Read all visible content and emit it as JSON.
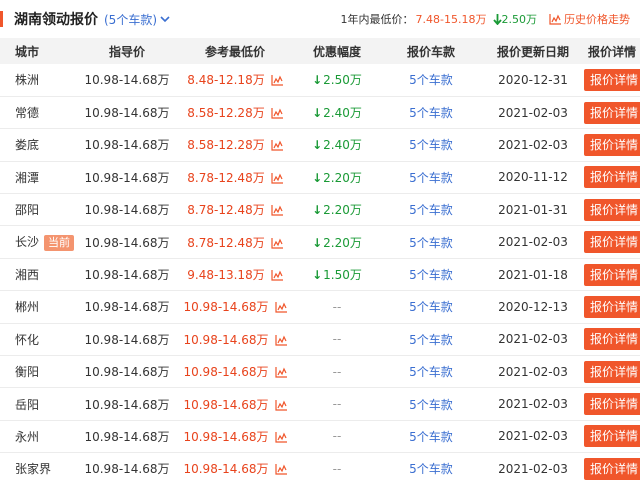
{
  "header": {
    "title": "湖南领动报价",
    "model_count": "(5个车款)",
    "lowest_label": "1年内最低价：",
    "lowest_range": "7.48-15.18万",
    "max_discount": "2.50万",
    "history_label": "历史价格走势"
  },
  "columns": {
    "city": "城市",
    "msrp": "指导价",
    "ref_price": "参考最低价",
    "discount": "优惠幅度",
    "models": "报价车款",
    "updated": "报价更新日期",
    "details": "报价详情"
  },
  "current_badge": "当前",
  "rows": [
    {
      "city": "株洲",
      "msrp": "10.98-14.68万",
      "ref": "8.48-12.18万",
      "disc": "2.50万",
      "models": "5个车款",
      "date": "2020-12-31",
      "btn": "报价详情"
    },
    {
      "city": "常德",
      "msrp": "10.98-14.68万",
      "ref": "8.58-12.28万",
      "disc": "2.40万",
      "models": "5个车款",
      "date": "2021-02-03",
      "btn": "报价详情"
    },
    {
      "city": "娄底",
      "msrp": "10.98-14.68万",
      "ref": "8.58-12.28万",
      "disc": "2.40万",
      "models": "5个车款",
      "date": "2021-02-03",
      "btn": "报价详情"
    },
    {
      "city": "湘潭",
      "msrp": "10.98-14.68万",
      "ref": "8.78-12.48万",
      "disc": "2.20万",
      "models": "5个车款",
      "date": "2020-11-12",
      "btn": "报价详情"
    },
    {
      "city": "邵阳",
      "msrp": "10.98-14.68万",
      "ref": "8.78-12.48万",
      "disc": "2.20万",
      "models": "5个车款",
      "date": "2021-01-31",
      "btn": "报价详情"
    },
    {
      "city": "长沙",
      "msrp": "10.98-14.68万",
      "ref": "8.78-12.48万",
      "disc": "2.20万",
      "models": "5个车款",
      "date": "2021-02-03",
      "btn": "报价详情"
    },
    {
      "city": "湘西",
      "msrp": "10.98-14.68万",
      "ref": "9.48-13.18万",
      "disc": "1.50万",
      "models": "5个车款",
      "date": "2021-01-18",
      "btn": "报价详情"
    },
    {
      "city": "郴州",
      "msrp": "10.98-14.68万",
      "ref": "10.98-14.68万",
      "disc": "--",
      "models": "5个车款",
      "date": "2020-12-13",
      "btn": "报价详情"
    },
    {
      "city": "怀化",
      "msrp": "10.98-14.68万",
      "ref": "10.98-14.68万",
      "disc": "--",
      "models": "5个车款",
      "date": "2021-02-03",
      "btn": "报价详情"
    },
    {
      "city": "衡阳",
      "msrp": "10.98-14.68万",
      "ref": "10.98-14.68万",
      "disc": "--",
      "models": "5个车款",
      "date": "2021-02-03",
      "btn": "报价详情"
    },
    {
      "city": "岳阳",
      "msrp": "10.98-14.68万",
      "ref": "10.98-14.68万",
      "disc": "--",
      "models": "5个车款",
      "date": "2021-02-03",
      "btn": "报价详情"
    },
    {
      "city": "永州",
      "msrp": "10.98-14.68万",
      "ref": "10.98-14.68万",
      "disc": "--",
      "models": "5个车款",
      "date": "2021-02-03",
      "btn": "报价详情"
    },
    {
      "city": "张家界",
      "msrp": "10.98-14.68万",
      "ref": "10.98-14.68万",
      "disc": "--",
      "models": "5个车款",
      "date": "2021-02-03",
      "btn": "报价详情"
    }
  ]
}
